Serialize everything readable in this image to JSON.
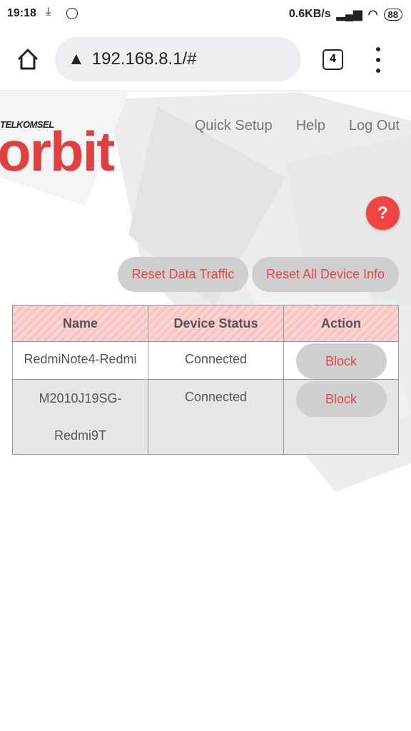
{
  "status_bar": {
    "time": "19:18",
    "speed": "0.6KB/s",
    "battery": "88",
    "icons": [
      "download-icon",
      "whatsapp-icon",
      "signal-icon",
      "wifi-icon"
    ]
  },
  "browser": {
    "url": "192.168.8.1/#",
    "tab_count": "4"
  },
  "logo": {
    "brand": "TELKOMSEL",
    "product": "orbit"
  },
  "nav": [
    "Quick Setup",
    "Help",
    "Log Out"
  ],
  "help_icon": "?",
  "buttons": {
    "reset_traffic": "Reset Data Traffic",
    "reset_all": "Reset All Device Info"
  },
  "table": {
    "headers": [
      "Name",
      "Device Status",
      "Action"
    ],
    "rows": [
      {
        "name": "RedmiNote4-Redmi",
        "status": "Connected",
        "action": "Block"
      },
      {
        "name_line1": "M2010J19SG-",
        "name_line2": "Redmi9T",
        "status": "Connected",
        "action": "Block"
      }
    ]
  },
  "colors": {
    "accent": "#e04040",
    "help": "#ef4444",
    "button": "#cfcfcf"
  }
}
